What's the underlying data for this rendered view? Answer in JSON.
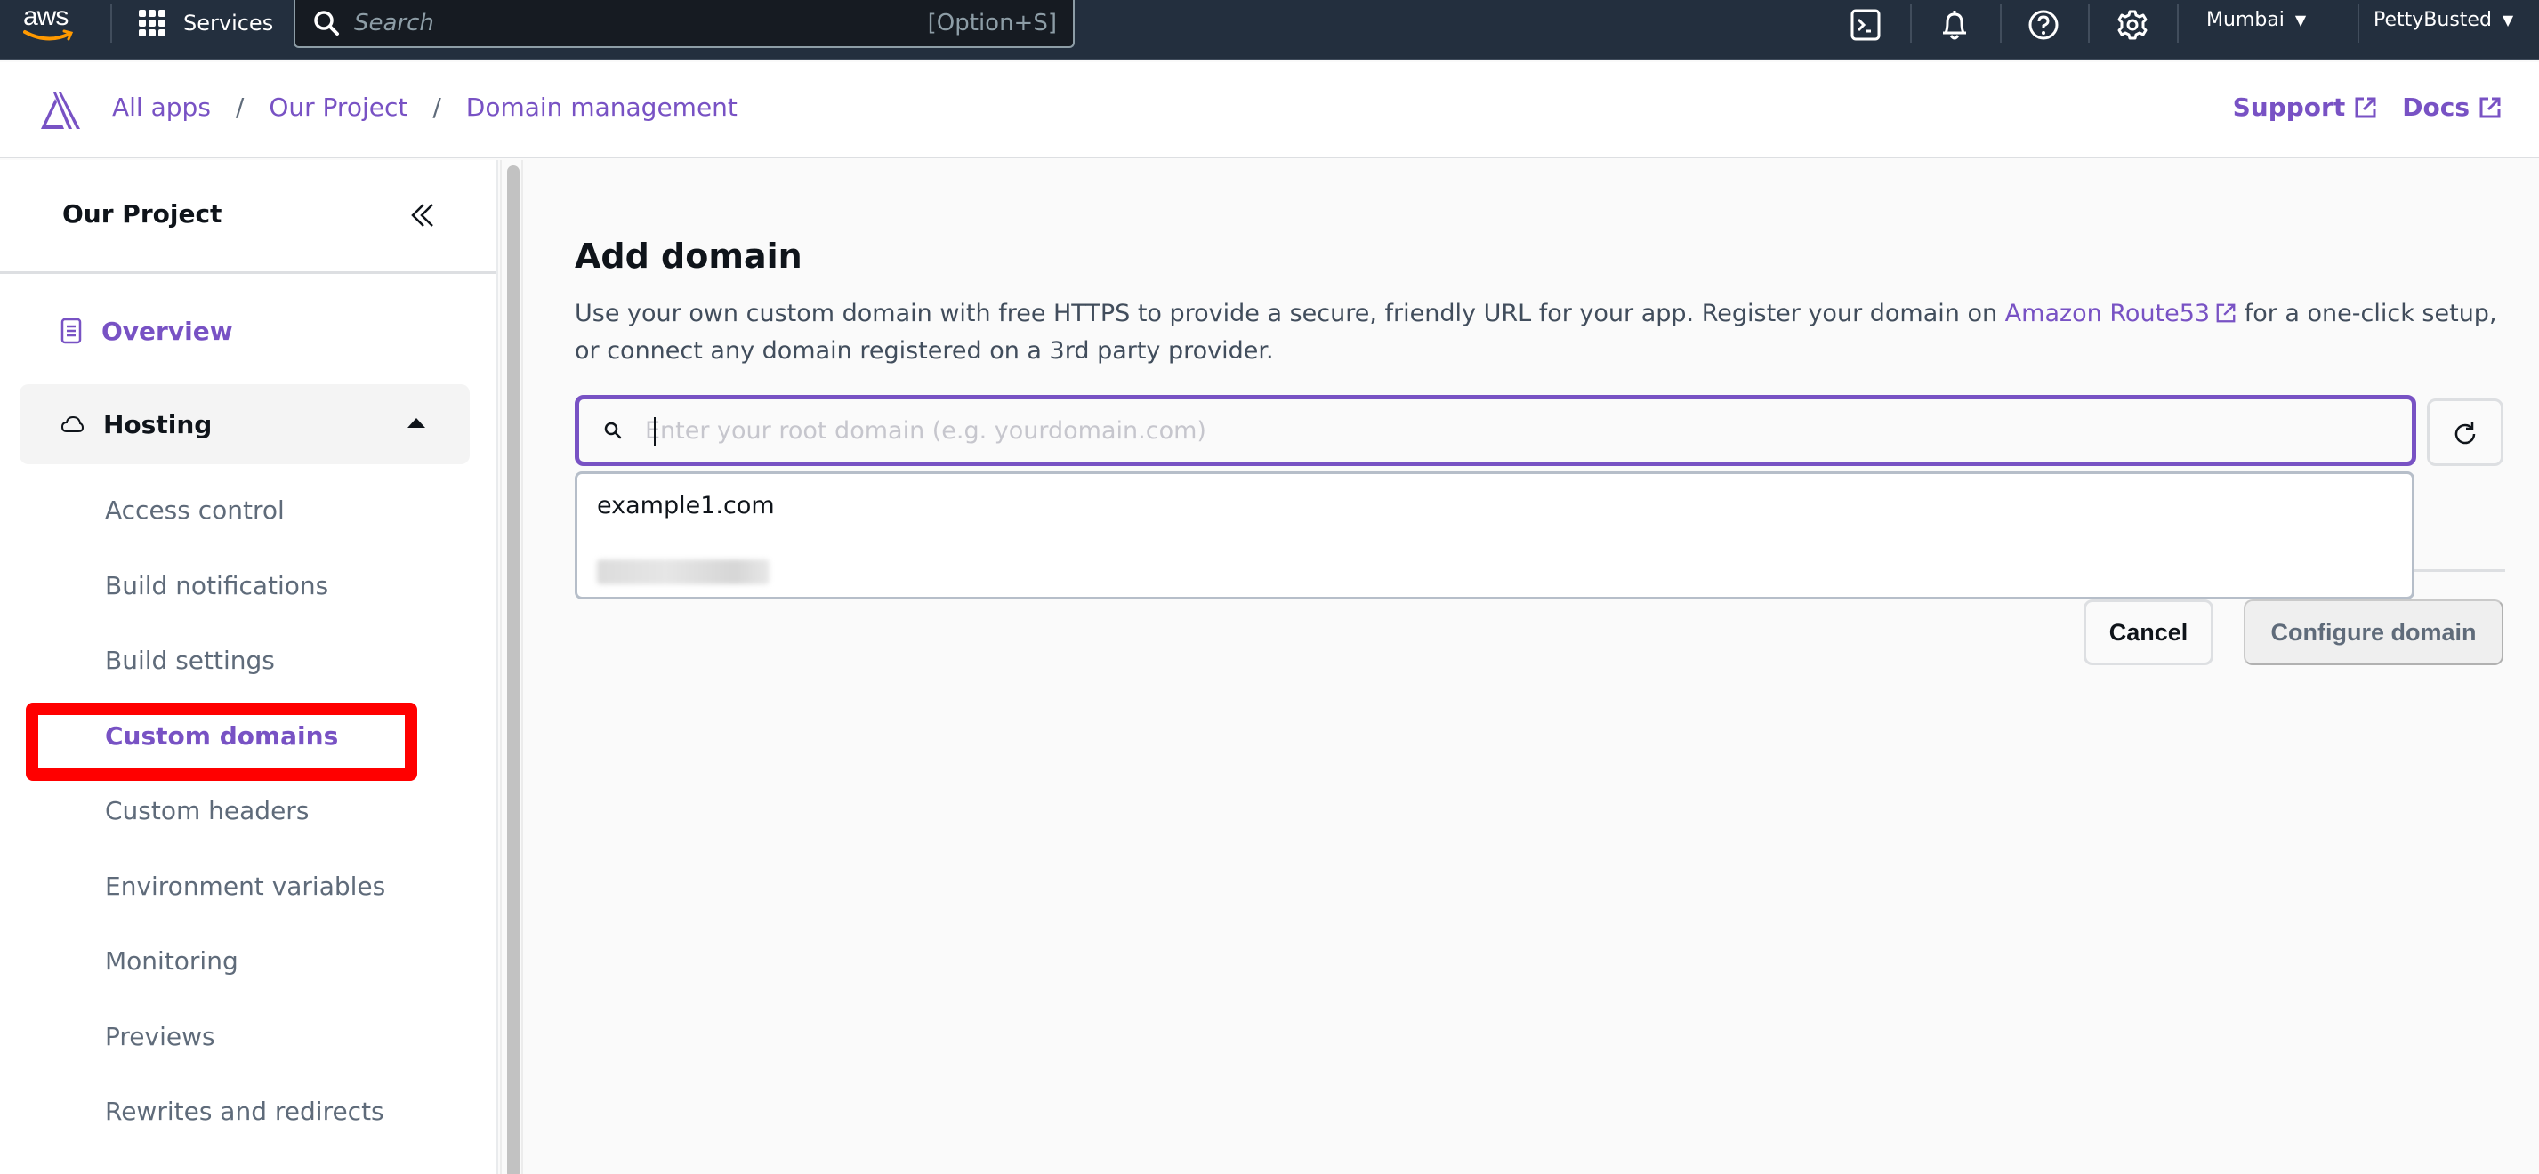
{
  "topbar": {
    "logo_text": "aws",
    "services_label": "Services",
    "search_placeholder": "Search",
    "search_shortcut": "[Option+S]",
    "icons": [
      "cloudshell-icon",
      "bell-icon",
      "help-icon",
      "gear-icon"
    ],
    "region": "Mumbai",
    "account": "PettyBusted",
    "caret": "▼"
  },
  "breadcrumb": {
    "items": [
      "All apps",
      "Our Project",
      "Domain management"
    ],
    "separator": "/"
  },
  "header_links": {
    "support": "Support",
    "docs": "Docs"
  },
  "sidebar": {
    "title": "Our Project",
    "overview": "Overview",
    "hosting": "Hosting",
    "sub_items": [
      "Access control",
      "Build notifications",
      "Build settings",
      "Custom domains",
      "Custom headers",
      "Environment variables",
      "Monitoring",
      "Previews",
      "Rewrites and redirects"
    ],
    "active_item": "Custom domains"
  },
  "main": {
    "title": "Add domain",
    "description_before": "Use your own custom domain with free HTTPS to provide a secure, friendly URL for your app. Register your domain on ",
    "description_link": "Amazon Route53",
    "description_after": " for a one-click setup, or connect any domain registered on a 3rd party provider.",
    "input_placeholder": "Enter your root domain (e.g. yourdomain.com)",
    "input_value": "",
    "dropdown_options": [
      "example1.com",
      "[blurred]"
    ],
    "cancel_label": "Cancel",
    "configure_label": "Configure domain"
  },
  "colors": {
    "accent": "#7852c4",
    "topbar_bg": "#232f3e",
    "highlight": "#ff0000"
  }
}
